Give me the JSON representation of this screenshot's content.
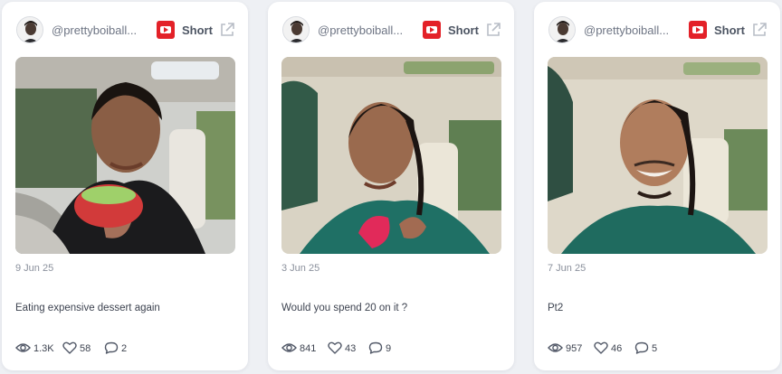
{
  "cards": [
    {
      "author": {
        "handle": "@prettyboiball..."
      },
      "media_type": {
        "label": "Short",
        "icon": "youtube-icon"
      },
      "open_icon": "external-link-icon",
      "thumbnail_alt": "",
      "date": "9 Jun 25",
      "caption": "Eating expensive dessert again",
      "stats": {
        "views": "1.3K",
        "likes": "58",
        "comments": "2"
      }
    },
    {
      "author": {
        "handle": "@prettyboiball..."
      },
      "media_type": {
        "label": "Short",
        "icon": "youtube-icon"
      },
      "open_icon": "external-link-icon",
      "thumbnail_alt": "",
      "date": "3 Jun 25",
      "caption": "Would you spend 20 on it ?",
      "stats": {
        "views": "841",
        "likes": "43",
        "comments": "9"
      }
    },
    {
      "author": {
        "handle": "@prettyboiball..."
      },
      "media_type": {
        "label": "Short",
        "icon": "youtube-icon"
      },
      "open_icon": "external-link-icon",
      "thumbnail_alt": "",
      "date": "7 Jun 25",
      "caption": "Pt2",
      "stats": {
        "views": "957",
        "likes": "46",
        "comments": "5"
      }
    }
  ],
  "colors": {
    "brand_youtube": "#e32128",
    "card_bg": "#ffffff",
    "page_bg": "#eef0f4",
    "muted_text": "#8a909c"
  },
  "icons": {
    "views": "eye-icon",
    "likes": "heart-icon",
    "comments": "comment-icon"
  }
}
